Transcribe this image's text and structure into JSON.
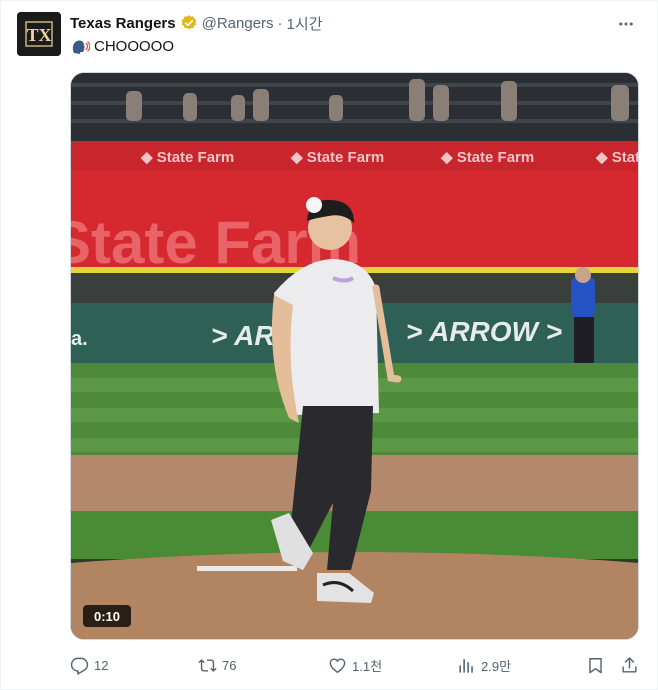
{
  "tweet": {
    "author_name": "Texas Rangers",
    "handle": "@Rangers",
    "separator": "·",
    "time": "1시간",
    "text": "CHOOOOO",
    "verified_color": "#e2b719"
  },
  "media": {
    "duration": "0:10",
    "banner_text": "State Farm",
    "arrow_text": "ARROW"
  },
  "actions": {
    "replies": "12",
    "reposts": "76",
    "likes": "1.1천",
    "views": "2.9만"
  },
  "icons": {
    "avatar": "rangers-logo",
    "verified": "verified-badge-icon",
    "more": "more-icon",
    "emoji": "speaking-head-emoji",
    "reply": "reply-icon",
    "repost": "repost-icon",
    "like": "heart-icon",
    "views": "views-icon",
    "bookmark": "bookmark-icon",
    "share": "share-icon"
  }
}
